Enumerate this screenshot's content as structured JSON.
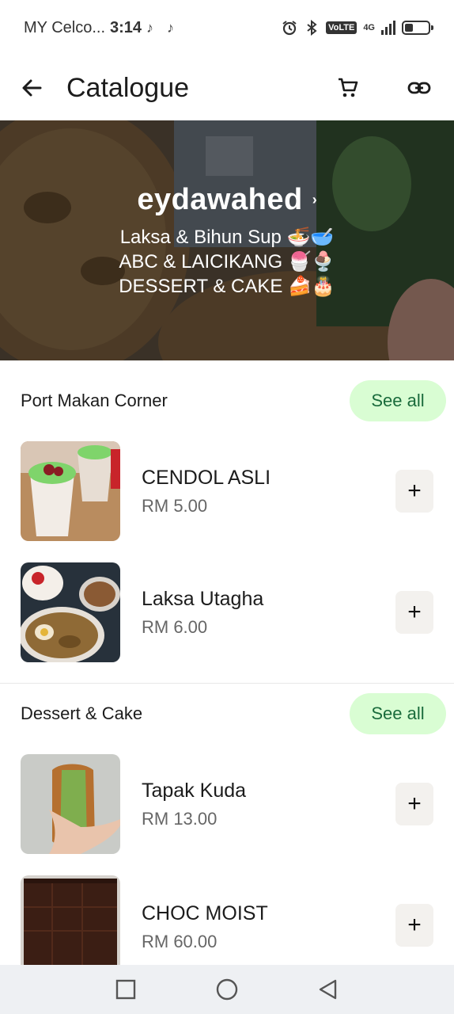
{
  "status_bar": {
    "carrier": "MY Celco...",
    "time": "3:14",
    "volte": "VoLTE",
    "network": "4G",
    "battery_level": 0.35
  },
  "app_bar": {
    "title": "Catalogue",
    "icons": [
      "arrow-back-icon",
      "cart-icon",
      "link-icon"
    ]
  },
  "hero": {
    "business_name": "eydawahed",
    "chevron": "›",
    "lines": [
      "Laksa & Bihun Sup 🍜🥣",
      "ABC & LAICIKANG 🍧🍨",
      "DESSERT & CAKE 🍰🎂"
    ]
  },
  "sections": [
    {
      "title": "Port Makan Corner",
      "see_all": "See all",
      "items": [
        {
          "name": "CENDOL ASLI",
          "price": "RM 5.00",
          "add": "+"
        },
        {
          "name": "Laksa Utagha",
          "price": "RM 6.00",
          "add": "+"
        }
      ]
    },
    {
      "title": "Dessert & Cake",
      "see_all": "See all",
      "items": [
        {
          "name": "Tapak Kuda",
          "price": "RM 13.00",
          "add": "+"
        },
        {
          "name": "CHOC MOIST",
          "price": "RM 60.00",
          "add": "+"
        }
      ]
    }
  ],
  "nav_bar": {
    "icons": [
      "recent-apps-icon",
      "home-icon",
      "back-icon"
    ]
  },
  "colors": {
    "see_all_bg": "#d9fdd3",
    "see_all_text": "#1a6b3c",
    "add_button_bg": "#f3f1ee",
    "nav_bar_bg": "#eef0f3"
  }
}
